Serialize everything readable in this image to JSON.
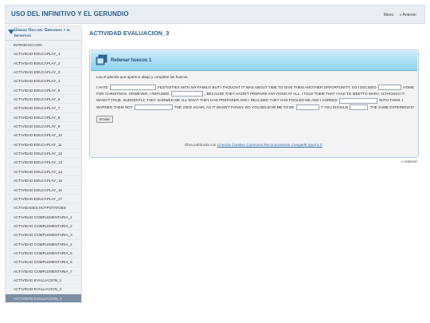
{
  "header": {
    "title": "USO DEL INFINITIVO Y EL GERUNDIO",
    "nav_menu": "Menú",
    "nav_prev": "« Anterior"
  },
  "sidebar": {
    "heading": "Unidad Uso del Gerundio y el Infinitivo",
    "items": [
      "INTRODUCCION",
      "ACTIVIDAD EDUCAPLAY_1",
      "ACTIVIDAD EDUCAPLAY_2",
      "ACTIVIDAD EDUCAPLAY_3",
      "ACTIVIDAD EDUCAPLAY_4",
      "ACTIVIDAD EDUCAPLAY_5",
      "ACTIVIDAD EDUCAPLAY_6",
      "ACTIVIDAD EDUCAPLAY_7",
      "ACTIVIDAD EDUCAPLAY_8",
      "ACTIVIDAD EDUCAPLAY_9",
      "ACTIVIDAD EDUCAPLAY_10",
      "ACTIVIDAD EDUCAPLAY_11",
      "ACTIVIDAD EDUCAPLAY_12",
      "ACTIVIDAD EDUCAPLAY_13",
      "ACTIVIDAD EDUCAPLAY_14",
      "ACTIVIDAD EDUCAPLAY_15",
      "ACTIVIDAD EDUCAPLAY_16",
      "ACTIVIDAD EDUCAPLAY_17",
      "ACTIVIDADES HOTPOTATOES",
      "ACTIVIDAD COMPLEMENTARIA_1",
      "ACTIVIDAD COMPLEMENTARIA_2",
      "ACTIVIDAD COMPLEMENTARIA_3",
      "ACTIVIDAD COMPLEMENTARIA_4",
      "ACTIVIDAD COMPLEMENTARIA_5",
      "ACTIVIDAD COMPLEMENTARIA_6",
      "ACTIVIDAD COMPLEMENTARIA_7",
      "ACTIVIDAD EVALUACION_1",
      "ACTIVIDAD EVALUACION_2",
      "ACTIVIDAD EVALUACION_3"
    ],
    "active_index": 28
  },
  "main": {
    "page_title": "ACTIVIDAD EVALUACION_3",
    "panel_title": "Rellenar huecos 1",
    "instructions": "Lea el párrafo que aparece abajo y complete las huecos.",
    "text": {
      "t1": "I HATE",
      "t2": "FESTIVITIES WITH MY FAMILY! BUT I THOUGHT IT WAS ABOUT TIME TO GIVE THEM ANOTHER OPPORTUNITY, SO  I DECIDED",
      "t3": "HOME FOR CHRISTMAS. HOWEVER, I REFUSED",
      "t4": ", BECAUSE THEY HADN'T PREPARE ANY FOOD AT ALL. I TOLD THEM THAT I HAD TO MEETTO MARY, ALTHOUGH IT WASN'T TRUE. SUDDENTLY, THEY SHOWED ME ALL WHAT THEY HAD PREPARER  AND I REALISED THEY HAD FOOLED ME AND I AGREED",
      "t5": "WITH THEM. I WARNED THEM NOT",
      "t6": "THE JOKE AGAIN, AS IT WASN'T FUNNY. DO YOU BELIEVE ME TO BE",
      "t7": "? YOU SHOULD",
      "t8": "THE SAME EXPERIENCE!"
    },
    "submit_label": "Enviar",
    "license_prefix": "Obra publicada con",
    "license_link": "Licencia Creative Commons Reconocimiento Compartir igual 4.0",
    "bottom_prev": "« Anterior"
  },
  "colors": {
    "header_bg": "#e8eef4",
    "title_blue": "#2a5d8a",
    "sidebar_bg": "#eef1f4",
    "active_item": "#7b8ea3",
    "panel_head": "#8fd3f0"
  },
  "icons": [
    "sidebar-collapse-arrow-icon",
    "exercise-window-icon"
  ]
}
